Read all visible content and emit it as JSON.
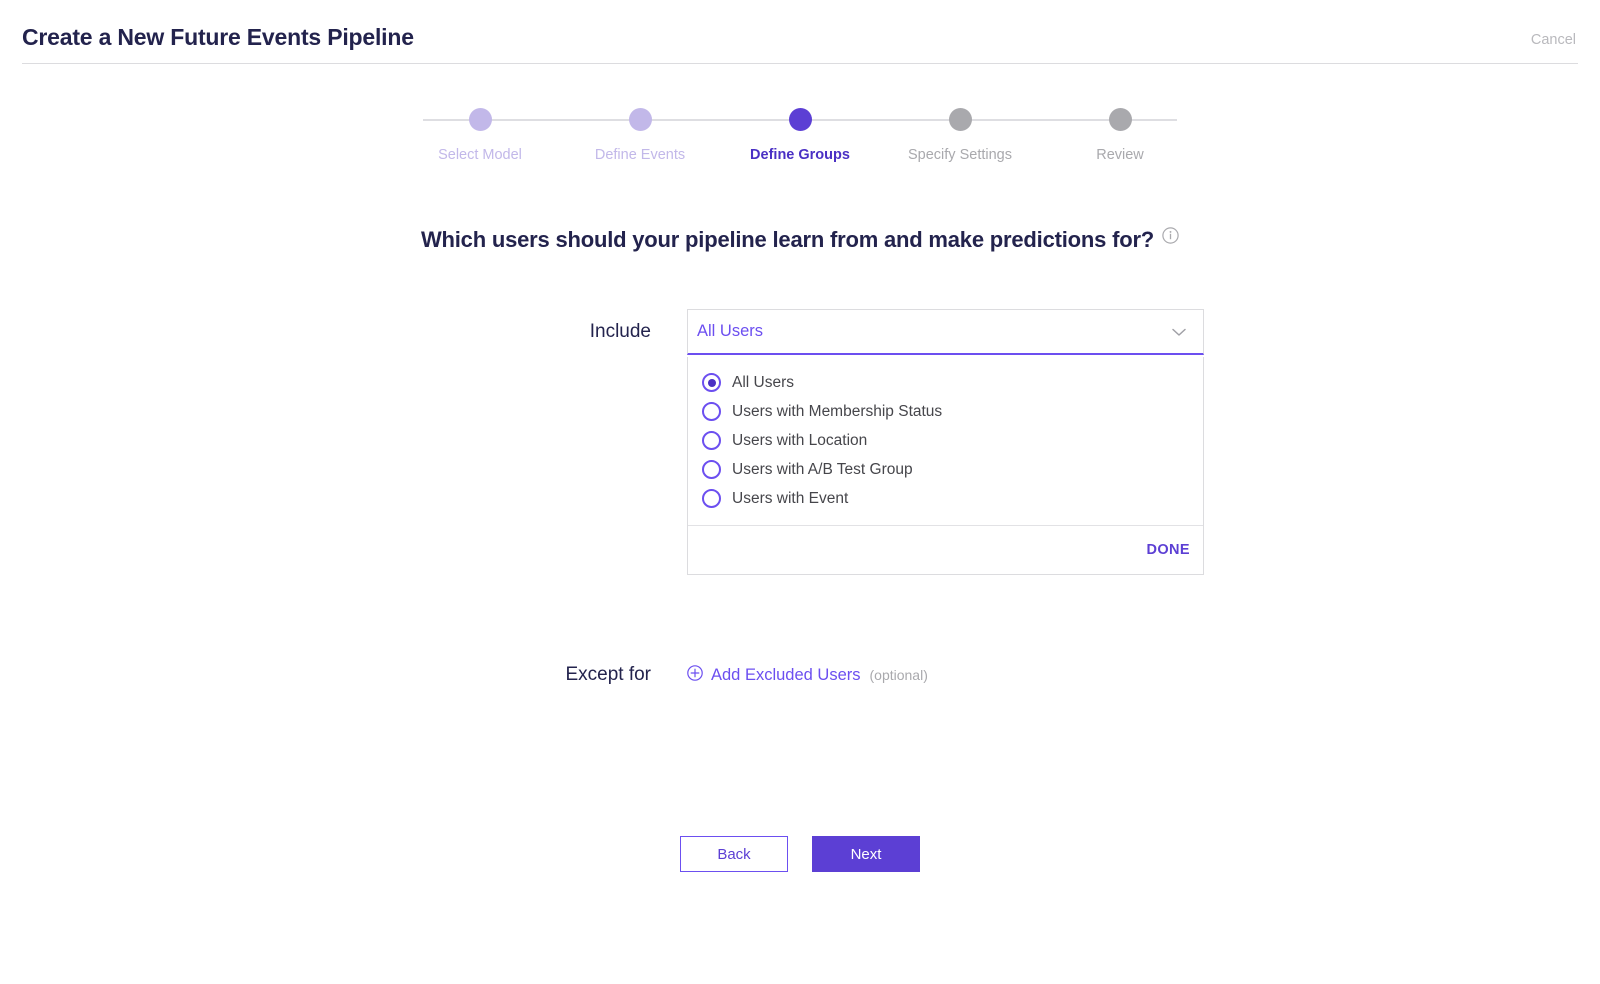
{
  "header": {
    "title": "Create a New Future Events Pipeline",
    "cancel_label": "Cancel"
  },
  "stepper": {
    "steps": [
      {
        "label": "Select Model",
        "state": "done"
      },
      {
        "label": "Define Events",
        "state": "done"
      },
      {
        "label": "Define Groups",
        "state": "active"
      },
      {
        "label": "Specify Settings",
        "state": "upcoming"
      },
      {
        "label": "Review",
        "state": "upcoming"
      }
    ]
  },
  "main": {
    "question": "Which users should your pipeline learn from and make predictions for?",
    "info_icon": "info-circle-icon",
    "include": {
      "label": "Include",
      "selected_value": "All Users",
      "chevron_icon": "chevron-down-icon",
      "options": [
        {
          "label": "All Users",
          "selected": true
        },
        {
          "label": "Users with Membership Status",
          "selected": false
        },
        {
          "label": "Users with Location",
          "selected": false
        },
        {
          "label": "Users with A/B Test Group",
          "selected": false
        },
        {
          "label": "Users with Event",
          "selected": false
        }
      ],
      "done_label": "DONE"
    },
    "except_for": {
      "label": "Except for",
      "add_icon": "plus-circle-icon",
      "add_label": "Add Excluded Users",
      "optional_label": "(optional)"
    }
  },
  "footer": {
    "back_label": "Back",
    "next_label": "Next"
  },
  "colors": {
    "accent": "#5c3fd4",
    "accent_light": "#6c4ff0",
    "step_done": "#c2b8e9",
    "step_upcoming": "#a9a9ad",
    "text_dark": "#23234d"
  }
}
